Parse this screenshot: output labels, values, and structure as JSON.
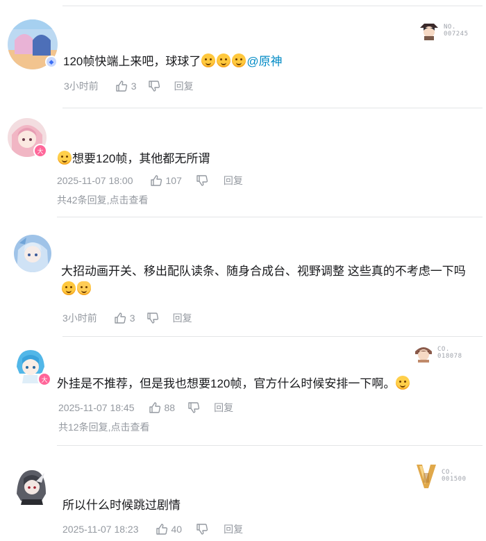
{
  "comments": [
    {
      "text": "120帧快端上来吧，球球了",
      "mention": "@原神",
      "time": "3小时前",
      "likes": "3",
      "reply": "回复",
      "medal": {
        "label": "NO.",
        "number": "007245"
      }
    },
    {
      "text": "想要120帧，其他都无所谓",
      "time": "2025-11-07 18:00",
      "likes": "107",
      "reply": "回复",
      "sub_count": "共42条回复,",
      "sub_link": "点击查看"
    },
    {
      "text": "大招动画开关、移出配队读条、随身合成台、视野调整 这些真的不考虑一下吗",
      "time": "3小时前",
      "likes": "3",
      "reply": "回复"
    },
    {
      "text": "外挂是不推荐，但是我也想要120帧，官方什么时候安排一下啊。",
      "time": "2025-11-07 18:45",
      "likes": "88",
      "reply": "回复",
      "sub_count": "共12条回复,",
      "sub_link": "点击查看",
      "medal": {
        "label": "CO.",
        "number": "018078"
      }
    },
    {
      "text": "所以什么时候跳过剧情",
      "time": "2025-11-07 18:23",
      "likes": "40",
      "reply": "回复",
      "medal": {
        "label": "CO.",
        "number": "001500"
      }
    }
  ],
  "colors": {
    "mention": "#008ac5",
    "meta": "#9499a0",
    "divider": "#e3e5e7",
    "vip_badge": "#ff6699"
  }
}
